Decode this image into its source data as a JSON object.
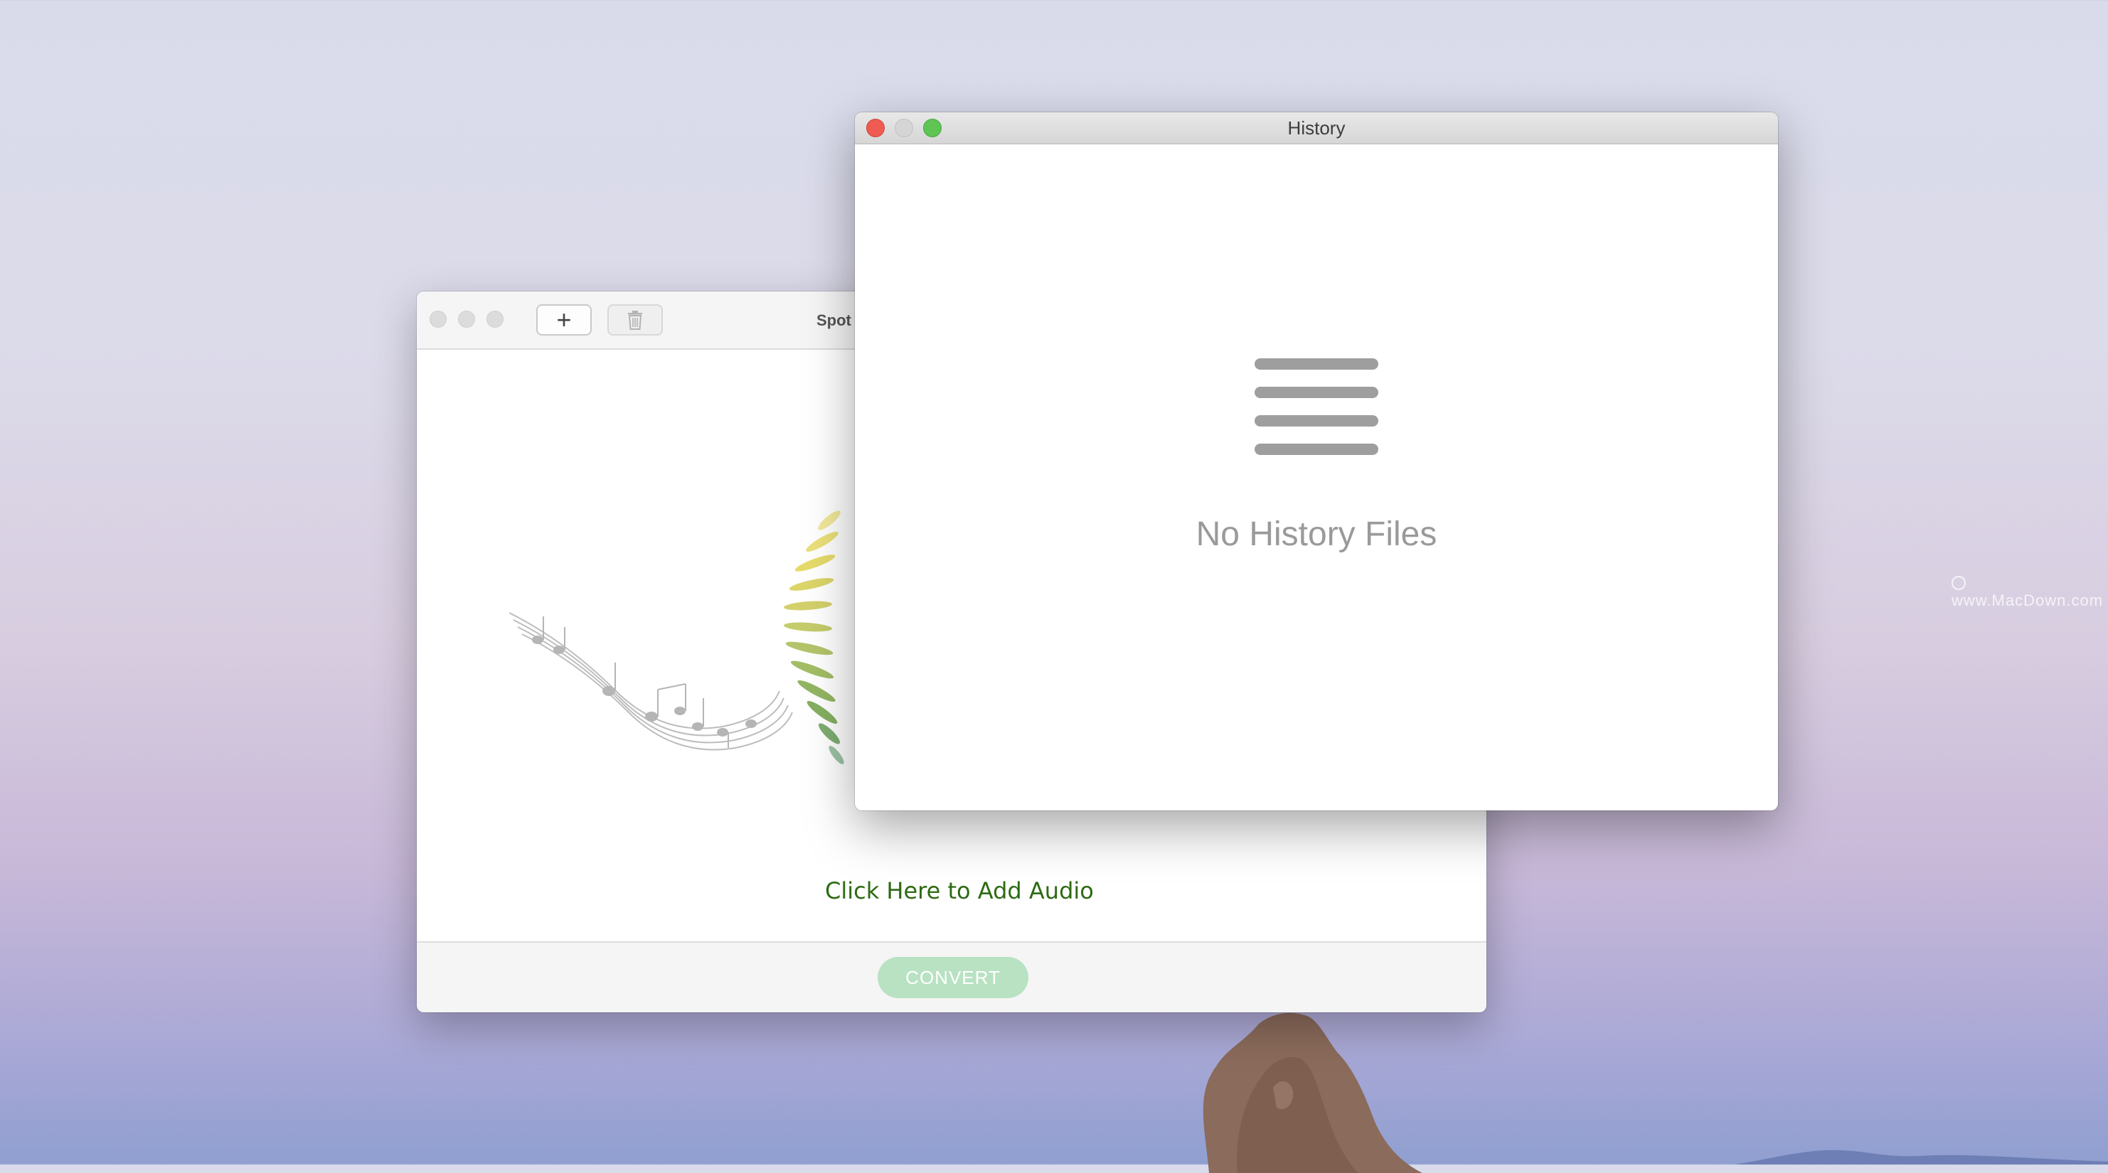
{
  "desktop": {
    "watermark": "www.MacDown.com"
  },
  "main_window": {
    "title": "Spot",
    "toolbar": {
      "add_button_label": "+",
      "delete_button_icon": "trash-icon"
    },
    "drop_area_label": "Click Here to Add Audio",
    "convert_label": "CONVERT",
    "colors": {
      "add_audio_text": "#2e6b12",
      "convert_button": "#b8e2c2"
    }
  },
  "history_window": {
    "title": "History",
    "empty_icon": "list-icon",
    "empty_message": "No History Files",
    "colors": {
      "close": "#ee5b50",
      "maximize": "#5fc454"
    }
  }
}
